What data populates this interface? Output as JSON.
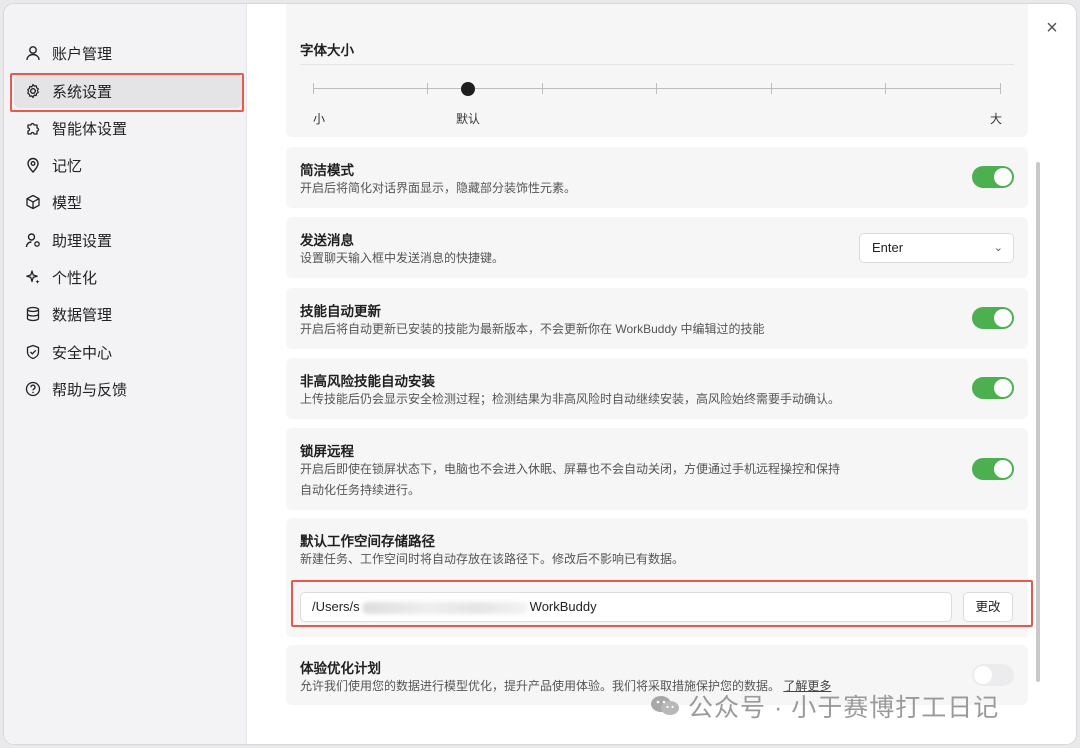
{
  "sidebar": {
    "items": [
      {
        "label": "账户管理",
        "icon": "user-icon"
      },
      {
        "label": "系统设置",
        "icon": "gear-icon"
      },
      {
        "label": "智能体设置",
        "icon": "puzzle-icon"
      },
      {
        "label": "记忆",
        "icon": "pin-icon"
      },
      {
        "label": "模型",
        "icon": "cube-icon"
      },
      {
        "label": "助理设置",
        "icon": "user-gear-icon"
      },
      {
        "label": "个性化",
        "icon": "sparkle-icon"
      },
      {
        "label": "数据管理",
        "icon": "database-icon"
      },
      {
        "label": "安全中心",
        "icon": "shield-icon"
      },
      {
        "label": "帮助与反馈",
        "icon": "help-icon"
      }
    ],
    "active_index": 1
  },
  "close_label": "×",
  "font_size": {
    "title": "字体大小",
    "min_label": "小",
    "default_label": "默认",
    "max_label": "大",
    "current_level": "默认"
  },
  "settings": {
    "compact_mode": {
      "title": "简洁模式",
      "desc": "开启后将简化对话界面显示，隐藏部分装饰性元素。",
      "enabled": true
    },
    "send_message": {
      "title": "发送消息",
      "desc": "设置聊天输入框中发送消息的快捷键。",
      "value": "Enter"
    },
    "skill_update": {
      "title": "技能自动更新",
      "desc": "开启后将自动更新已安装的技能为最新版本，不会更新你在 WorkBuddy 中编辑过的技能",
      "enabled": true
    },
    "low_risk_install": {
      "title": "非高风险技能自动安装",
      "desc": "上传技能后仍会显示安全检测过程；检测结果为非高风险时自动继续安装，高风险始终需要手动确认。",
      "enabled": true
    },
    "lock_screen_remote": {
      "title": "锁屏远程",
      "desc_line1": "开启后即使在锁屏状态下，电脑也不会进入休眠、屏幕也不会自动关闭，方便通过手机远程操控和保持",
      "desc_line2": "自动化任务持续进行。",
      "enabled": true
    },
    "workspace_path": {
      "title": "默认工作空间存储路径",
      "desc": "新建任务、工作空间时将自动存放在该路径下。修改后不影响已有数据。",
      "path_prefix": "/Users/s",
      "path_suffix": "WorkBuddy",
      "change_label": "更改"
    },
    "experience_plan": {
      "title": "体验优化计划",
      "desc": "允许我们使用您的数据进行模型优化，提升产品使用体验。我们将采取措施保护您的数据。",
      "link": "了解更多",
      "enabled": false
    }
  },
  "watermark": "公众号 · 小于赛博打工日记",
  "colors": {
    "toggle_on": "#4caf50",
    "highlight_box": "#e35a4f"
  }
}
